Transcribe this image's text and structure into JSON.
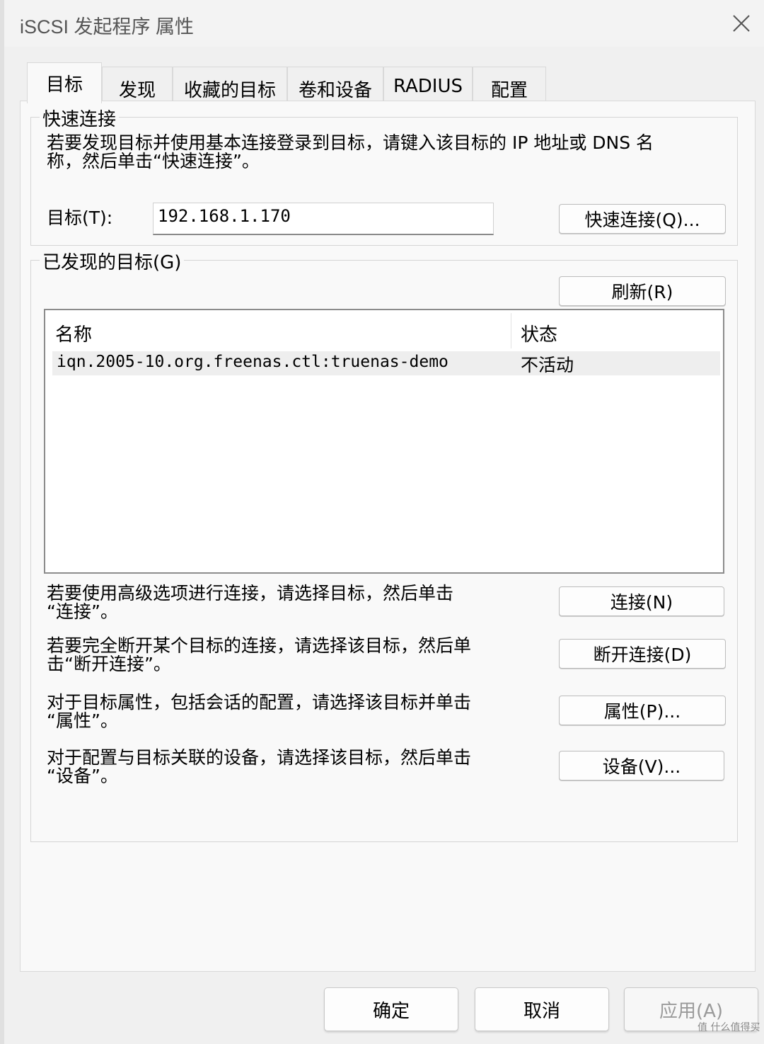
{
  "window": {
    "title": "iSCSI 发起程序 属性"
  },
  "tabs": [
    {
      "label": "目标",
      "active": true
    },
    {
      "label": "发现",
      "active": false
    },
    {
      "label": "收藏的目标",
      "active": false
    },
    {
      "label": "卷和设备",
      "active": false
    },
    {
      "label": "RADIUS",
      "active": false
    },
    {
      "label": "配置",
      "active": false
    }
  ],
  "quick_connect": {
    "group_label": "快速连接",
    "description_line1": "若要发现目标并使用基本连接登录到目标，请键入该目标的 IP 地址或 DNS 名",
    "description_line2": "称，然后单击“快速连接”。",
    "target_label": "目标(T):",
    "target_value": "192.168.1.170",
    "button_label": "快速连接(Q)..."
  },
  "discovered": {
    "group_label": "已发现的目标(G)",
    "refresh_label": "刷新(R)",
    "columns": [
      "名称",
      "状态"
    ],
    "rows": [
      {
        "name": "iqn.2005-10.org.freenas.ctl:truenas-demo",
        "status": "不活动"
      }
    ]
  },
  "actions": [
    {
      "line1": "若要使用高级选项进行连接，请选择目标，然后单击",
      "line2": "“连接”。",
      "button": "连接(N)"
    },
    {
      "line1": "若要完全断开某个目标的连接，请选择该目标，然后单",
      "line2": "击“断开连接”。",
      "button": "断开连接(D)"
    },
    {
      "line1": "对于目标属性，包括会话的配置，请选择该目标并单击",
      "line2": "“属性”。",
      "button": "属性(P)..."
    },
    {
      "line1": "对于配置与目标关联的设备，请选择该目标，然后单击",
      "line2": "“设备”。",
      "button": "设备(V)..."
    }
  ],
  "footer": {
    "ok": "确定",
    "cancel": "取消",
    "apply": "应用(A)"
  },
  "watermark": "值 什么值得买"
}
